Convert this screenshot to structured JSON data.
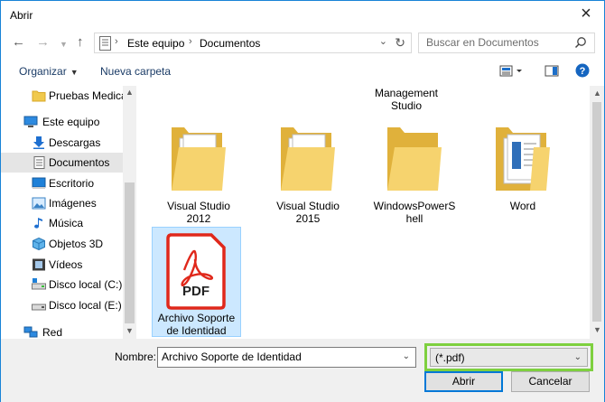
{
  "window": {
    "title": "Abrir"
  },
  "address": {
    "crumbs": [
      "Este equipo",
      "Documentos"
    ]
  },
  "search": {
    "placeholder": "Buscar en Documentos"
  },
  "toolbar": {
    "organize_label": "Organizar",
    "new_folder_label": "Nueva carpeta"
  },
  "sidebar": {
    "items": [
      {
        "label": "Pruebas Medicas",
        "icon": "folder-icon"
      },
      {
        "label": "Este equipo",
        "icon": "computer-icon"
      },
      {
        "label": "Descargas",
        "icon": "download-icon"
      },
      {
        "label": "Documentos",
        "icon": "documents-icon"
      },
      {
        "label": "Escritorio",
        "icon": "desktop-icon"
      },
      {
        "label": "Imágenes",
        "icon": "pictures-icon"
      },
      {
        "label": "Música",
        "icon": "music-icon"
      },
      {
        "label": "Objetos 3D",
        "icon": "3d-objects-icon"
      },
      {
        "label": "Vídeos",
        "icon": "videos-icon"
      },
      {
        "label": "Disco local (C:)",
        "icon": "drive-icon"
      },
      {
        "label": "Disco local (E:)",
        "icon": "drive-icon"
      },
      {
        "label": "Red",
        "icon": "network-icon"
      }
    ]
  },
  "content": {
    "partial_top_label": [
      "Management",
      "Studio"
    ],
    "items": [
      {
        "label_lines": [
          "Visual Studio",
          "2012"
        ],
        "type": "folder"
      },
      {
        "label_lines": [
          "Visual Studio",
          "2015"
        ],
        "type": "folder"
      },
      {
        "label_lines": [
          "WindowsPowerS",
          "hell"
        ],
        "type": "folder"
      },
      {
        "label_lines": [
          "Word"
        ],
        "type": "folder"
      },
      {
        "label_lines": [
          "Archivo Soporte",
          "de Identidad"
        ],
        "type": "pdf",
        "badge": "PDF"
      }
    ]
  },
  "bottom": {
    "name_label": "Nombre:",
    "name_value": "Archivo Soporte de Identidad",
    "filter_value": "(*.pdf)",
    "open_label": "Abrir",
    "cancel_label": "Cancelar"
  },
  "colors": {
    "accent": "#0078d7",
    "highlight_border": "#7ed03f",
    "selection": "#cce8ff",
    "pdf_red": "#e0281b"
  }
}
